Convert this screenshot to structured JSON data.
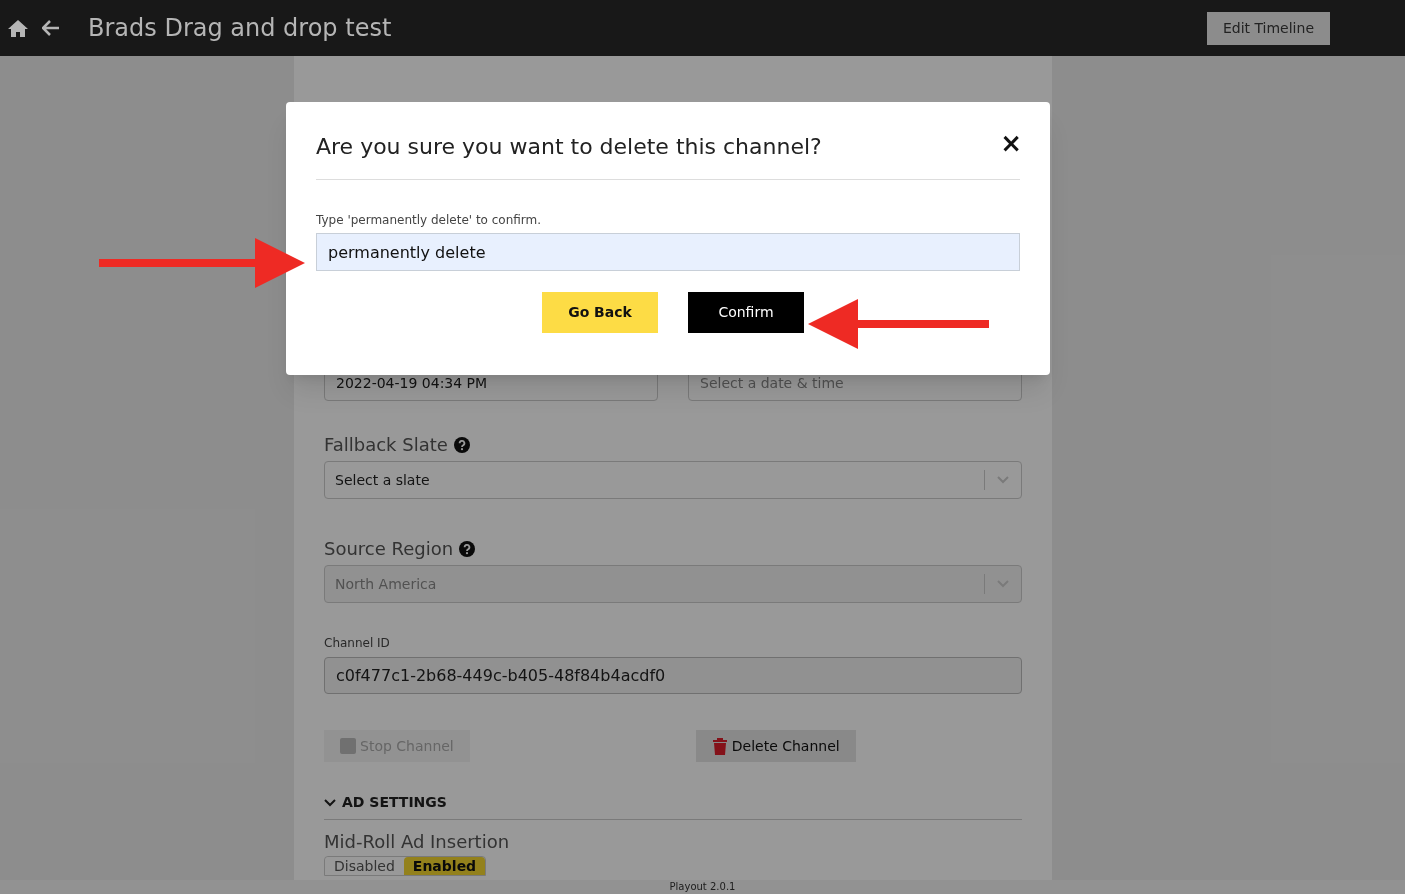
{
  "header": {
    "title": "Brads Drag and drop test",
    "action": "Edit Timeline"
  },
  "form": {
    "start_time": {
      "value": "2022-04-19 04:34 PM"
    },
    "end_time": {
      "placeholder": "Select a date & time"
    },
    "fallback_slate": {
      "label": "Fallback Slate",
      "value": "Select a slate",
      "disabled": false
    },
    "source_region": {
      "label": "Source Region",
      "value": "North America",
      "disabled": true
    },
    "channel_id": {
      "label": "Channel ID",
      "value": "c0f477c1-2b68-449c-b405-48f84b4acdf0"
    },
    "stop_button": {
      "label": "Stop Channel",
      "disabled": true
    },
    "delete_button": {
      "label": "Delete Channel",
      "disabled": false
    },
    "ad_settings": {
      "title": "AD SETTINGS",
      "expanded": true,
      "mid_roll": {
        "label": "Mid-Roll Ad Insertion",
        "options": [
          {
            "label": "Disabled",
            "selected": false
          },
          {
            "label": "Enabled",
            "selected": true
          }
        ]
      }
    }
  },
  "footer": "Playout 2.0.1",
  "dialog": {
    "title": "Are you sure you want to delete this channel?",
    "close": "×",
    "prompt": "Type 'permanently delete' to confirm.",
    "value": "permanently delete",
    "buttons": [
      {
        "label": "Go Back",
        "kind": "secondary"
      },
      {
        "label": "Confirm",
        "kind": "primary"
      }
    ]
  }
}
